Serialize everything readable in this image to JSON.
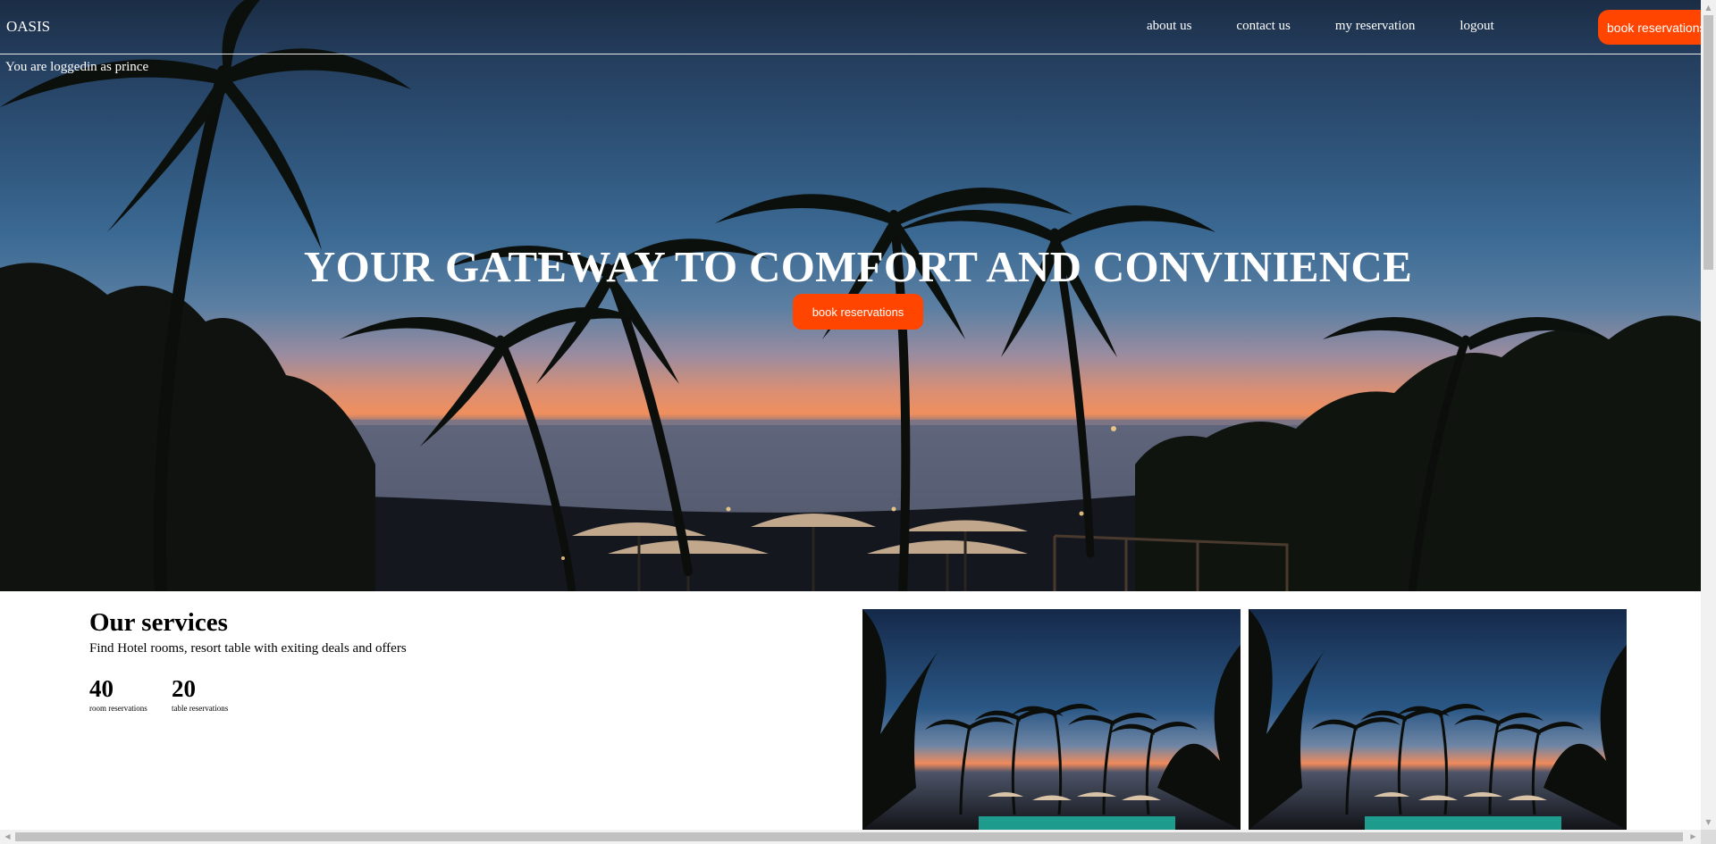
{
  "navbar": {
    "brand": "OASIS",
    "links": [
      {
        "label": "about us"
      },
      {
        "label": "contact us"
      },
      {
        "label": "my reservation"
      },
      {
        "label": "logout"
      }
    ],
    "cta_label": "book reservations"
  },
  "hero": {
    "login_status": "You are loggedin as prince",
    "title": "YOUR GATEWAY TO COMFORT AND CONVINIENCE",
    "cta_label": "book reservations"
  },
  "services": {
    "title": "Our services",
    "description": "Find Hotel rooms, resort table with exiting deals and offers",
    "stats": [
      {
        "value": "40",
        "label": "room reservations"
      },
      {
        "value": "20",
        "label": "table reservations"
      }
    ],
    "images": [
      {
        "icon": "resort-photo"
      },
      {
        "icon": "resort-photo"
      }
    ]
  },
  "colors": {
    "accent": "#ff4500",
    "nav_text": "#ffffff"
  }
}
